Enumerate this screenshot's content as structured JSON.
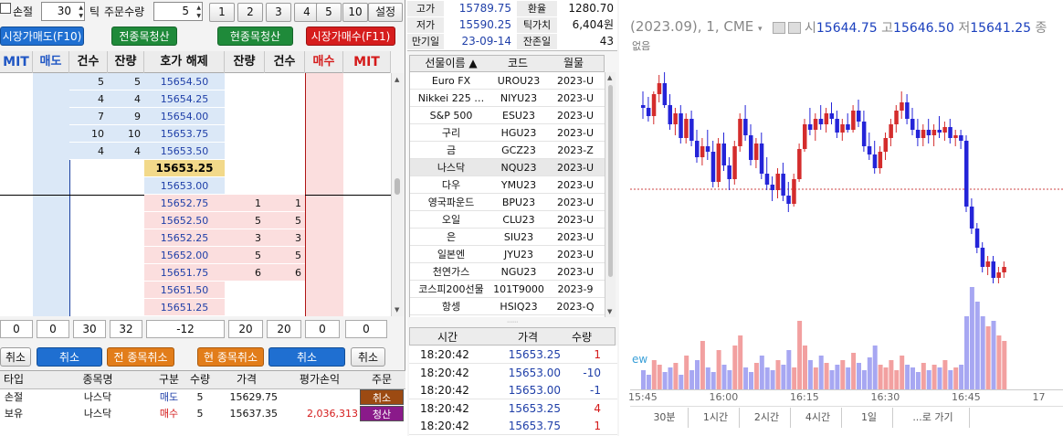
{
  "left": {
    "top": {
      "loss_label": "손절",
      "loss_value": "30",
      "tick_label": "틱",
      "qty_label": "주문수량",
      "qty_value": "5",
      "qty_buttons": [
        "1",
        "2",
        "3",
        "4",
        "5",
        "10"
      ],
      "settings_label": "설정"
    },
    "action_buttons": {
      "market_sell": "시장가매도(F10)",
      "all_close": "전종목청산",
      "cur_close": "현종목청산",
      "market_buy": "시장가매수(F11)"
    },
    "headers": {
      "mit_left": "MIT",
      "sell": "매도",
      "count": "건수",
      "remain": "잔량",
      "price": "호가 해제",
      "remain2": "잔량",
      "count2": "건수",
      "buy": "매수",
      "mit_right": "MIT"
    },
    "rows": [
      {
        "sc": "5",
        "sr": "5",
        "p": "15654.50",
        "br": "",
        "bc": ""
      },
      {
        "sc": "4",
        "sr": "4",
        "p": "15654.25",
        "br": "",
        "bc": ""
      },
      {
        "sc": "7",
        "sr": "9",
        "p": "15654.00",
        "br": "",
        "bc": ""
      },
      {
        "sc": "10",
        "sr": "10",
        "p": "15653.75",
        "br": "",
        "bc": ""
      },
      {
        "sc": "4",
        "sr": "4",
        "p": "15653.50",
        "br": "",
        "bc": ""
      },
      {
        "sc": "",
        "sr": "",
        "p": "15653.25",
        "br": "",
        "bc": ""
      },
      {
        "sc": "",
        "sr": "",
        "p": "15653.00",
        "br": "",
        "bc": ""
      },
      {
        "sc": "",
        "sr": "",
        "p": "15652.75",
        "br": "1",
        "bc": "1"
      },
      {
        "sc": "",
        "sr": "",
        "p": "15652.50",
        "br": "5",
        "bc": "5"
      },
      {
        "sc": "",
        "sr": "",
        "p": "15652.25",
        "br": "3",
        "bc": "3"
      },
      {
        "sc": "",
        "sr": "",
        "p": "15652.00",
        "br": "5",
        "bc": "5"
      },
      {
        "sc": "",
        "sr": "",
        "p": "15651.75",
        "br": "6",
        "bc": "6"
      },
      {
        "sc": "",
        "sr": "",
        "p": "15651.50",
        "br": "",
        "bc": ""
      },
      {
        "sc": "",
        "sr": "",
        "p": "15651.25",
        "br": "",
        "bc": ""
      }
    ],
    "totals": [
      "0",
      "0",
      "30",
      "32",
      "-12",
      "20",
      "20",
      "0",
      "0"
    ],
    "cancel_row": {
      "cancel1": "취소",
      "cancel2": "취소",
      "all_cancel": "전 종목취소",
      "cur_cancel": "현 종목취소",
      "cancel3": "취소",
      "cancel4": "취소"
    },
    "orders": {
      "headers": [
        "타입",
        "종목명",
        "구분",
        "수량",
        "가격",
        "평가손익",
        "주문"
      ],
      "rows": [
        {
          "type": "손절",
          "name": "나스닥",
          "side": "매도",
          "qty": "5",
          "price": "15629.75",
          "pnl": "",
          "action": "취소"
        },
        {
          "type": "보유",
          "name": "나스닥",
          "side": "매수",
          "qty": "5",
          "price": "15637.35",
          "pnl": "2,036,313",
          "action": "청산"
        }
      ]
    }
  },
  "mid": {
    "info": [
      {
        "l1": "고가",
        "v1": "15789.75",
        "l2": "환율",
        "v2": "1280.70"
      },
      {
        "l1": "저가",
        "v1": "15590.25",
        "l2": "틱가치",
        "v2": "6,404원"
      },
      {
        "l1": "만기일",
        "v1": "23-09-14",
        "l2": "잔존일",
        "v2": "43"
      }
    ],
    "list_headers": [
      "선물이름 ▲",
      "코드",
      "월물"
    ],
    "futures": [
      {
        "n": "Euro FX",
        "c": "UROU23",
        "m": "2023-U"
      },
      {
        "n": "Nikkei 225 …",
        "c": "NIYU23",
        "m": "2023-U"
      },
      {
        "n": "S&P 500",
        "c": "ESU23",
        "m": "2023-U"
      },
      {
        "n": "구리",
        "c": "HGU23",
        "m": "2023-U"
      },
      {
        "n": "금",
        "c": "GCZ23",
        "m": "2023-Z"
      },
      {
        "n": "나스닥",
        "c": "NQU23",
        "m": "2023-U"
      },
      {
        "n": "다우",
        "c": "YMU23",
        "m": "2023-U"
      },
      {
        "n": "영국파운드",
        "c": "BPU23",
        "m": "2023-U"
      },
      {
        "n": "오일",
        "c": "CLU23",
        "m": "2023-U"
      },
      {
        "n": "은",
        "c": "SIU23",
        "m": "2023-U"
      },
      {
        "n": "일본엔",
        "c": "JYU23",
        "m": "2023-U"
      },
      {
        "n": "천연가스",
        "c": "NGU23",
        "m": "2023-U"
      },
      {
        "n": "코스피200선물",
        "c": "101T9000",
        "m": "2023-9"
      },
      {
        "n": "항셍",
        "c": "HSIQ23",
        "m": "2023-Q"
      }
    ],
    "trade_headers": [
      "시간",
      "가격",
      "수량"
    ],
    "trades": [
      {
        "t": "18:20:42",
        "p": "15653.25",
        "q": "1",
        "d": "up"
      },
      {
        "t": "18:20:42",
        "p": "15653.00",
        "q": "-10",
        "d": "down"
      },
      {
        "t": "18:20:42",
        "p": "15653.00",
        "q": "-1",
        "d": "down"
      },
      {
        "t": "18:20:42",
        "p": "15653.25",
        "q": "4",
        "d": "up"
      },
      {
        "t": "18:20:42",
        "p": "15653.75",
        "q": "1",
        "d": "up"
      }
    ]
  },
  "chart": {
    "title": "(2023.09), 1, CME",
    "ohlc": {
      "o_label": "시",
      "o": "15644.75",
      "h_label": "고",
      "h": "15646.50",
      "l_label": "저",
      "l": "15641.25",
      "c_label": "종"
    },
    "sub_label": "없음",
    "vol_label": "ew",
    "times": [
      "15:45",
      "16:00",
      "16:15",
      "16:30",
      "16:45",
      "17"
    ],
    "toolbar": [
      "30분",
      "1시간",
      "2시간",
      "4시간",
      "1일",
      "...로 가기"
    ],
    "colors": {
      "up": "#d42c2c",
      "down": "#2424d8",
      "vol_up": "#f2a0a0",
      "vol_down": "#a7a7f2"
    }
  },
  "chart_data": {
    "type": "candlestick",
    "x_start": "15:45",
    "x_end": "17:00",
    "interval_min": 1,
    "price_range": [
      15560,
      15720
    ],
    "candles": [
      [
        15690,
        15700,
        15680,
        15688
      ],
      [
        15688,
        15696,
        15678,
        15682
      ],
      [
        15682,
        15700,
        15676,
        15698
      ],
      [
        15698,
        15712,
        15692,
        15706
      ],
      [
        15706,
        15714,
        15688,
        15690
      ],
      [
        15690,
        15698,
        15672,
        15676
      ],
      [
        15676,
        15688,
        15668,
        15684
      ],
      [
        15684,
        15690,
        15662,
        15666
      ],
      [
        15666,
        15684,
        15662,
        15680
      ],
      [
        15680,
        15686,
        15660,
        15664
      ],
      [
        15664,
        15672,
        15648,
        15652
      ],
      [
        15652,
        15666,
        15646,
        15660
      ],
      [
        15660,
        15672,
        15650,
        15656
      ],
      [
        15656,
        15664,
        15630,
        15634
      ],
      [
        15634,
        15666,
        15630,
        15662
      ],
      [
        15662,
        15670,
        15642,
        15646
      ],
      [
        15646,
        15652,
        15628,
        15636
      ],
      [
        15636,
        15664,
        15632,
        15660
      ],
      [
        15660,
        15684,
        15656,
        15680
      ],
      [
        15680,
        15690,
        15664,
        15668
      ],
      [
        15668,
        15676,
        15646,
        15650
      ],
      [
        15650,
        15666,
        15644,
        15662
      ],
      [
        15662,
        15670,
        15636,
        15640
      ],
      [
        15640,
        15652,
        15628,
        15632
      ],
      [
        15632,
        15638,
        15620,
        15628
      ],
      [
        15628,
        15644,
        15622,
        15640
      ],
      [
        15640,
        15648,
        15620,
        15624
      ],
      [
        15624,
        15634,
        15612,
        15618
      ],
      [
        15618,
        15640,
        15616,
        15636
      ],
      [
        15636,
        15662,
        15634,
        15658
      ],
      [
        15658,
        15680,
        15656,
        15676
      ],
      [
        15676,
        15688,
        15668,
        15672
      ],
      [
        15672,
        15684,
        15664,
        15680
      ],
      [
        15680,
        15690,
        15672,
        15676
      ],
      [
        15676,
        15688,
        15670,
        15684
      ],
      [
        15684,
        15692,
        15676,
        15680
      ],
      [
        15680,
        15686,
        15666,
        15670
      ],
      [
        15670,
        15680,
        15664,
        15676
      ],
      [
        15676,
        15684,
        15670,
        15672
      ],
      [
        15672,
        15690,
        15670,
        15686
      ],
      [
        15686,
        15694,
        15674,
        15678
      ],
      [
        15678,
        15686,
        15656,
        15660
      ],
      [
        15660,
        15670,
        15650,
        15654
      ],
      [
        15654,
        15664,
        15640,
        15644
      ],
      [
        15644,
        15660,
        15640,
        15656
      ],
      [
        15656,
        15670,
        15650,
        15666
      ],
      [
        15666,
        15680,
        15660,
        15676
      ],
      [
        15676,
        15690,
        15670,
        15686
      ],
      [
        15686,
        15700,
        15680,
        15692
      ],
      [
        15692,
        15698,
        15676,
        15680
      ],
      [
        15680,
        15688,
        15668,
        15672
      ],
      [
        15672,
        15680,
        15660,
        15666
      ],
      [
        15666,
        15676,
        15660,
        15672
      ],
      [
        15672,
        15680,
        15662,
        15668
      ],
      [
        15668,
        15676,
        15660,
        15672
      ],
      [
        15672,
        15682,
        15666,
        15670
      ],
      [
        15670,
        15678,
        15664,
        15674
      ],
      [
        15674,
        15680,
        15662,
        15666
      ],
      [
        15666,
        15672,
        15660,
        15668
      ],
      [
        15668,
        15672,
        15658,
        15664
      ],
      [
        15664,
        15668,
        15612,
        15616
      ],
      [
        15616,
        15622,
        15596,
        15600
      ],
      [
        15600,
        15604,
        15582,
        15586
      ],
      [
        15586,
        15590,
        15568,
        15572
      ],
      [
        15572,
        15580,
        15566,
        15576
      ],
      [
        15576,
        15580,
        15560,
        15564
      ],
      [
        15564,
        15572,
        15560,
        15568
      ],
      [
        15568,
        15576,
        15564,
        15572
      ]
    ],
    "volumes": [
      8,
      6,
      12,
      10,
      7,
      9,
      11,
      6,
      14,
      8,
      12,
      20,
      9,
      7,
      16,
      10,
      8,
      18,
      22,
      9,
      7,
      11,
      14,
      9,
      8,
      12,
      10,
      16,
      9,
      28,
      18,
      12,
      9,
      14,
      11,
      8,
      10,
      12,
      9,
      15,
      11,
      8,
      13,
      18,
      10,
      9,
      12,
      8,
      14,
      10,
      9,
      7,
      11,
      8,
      10,
      9,
      12,
      8,
      9,
      10,
      30,
      42,
      36,
      30,
      26,
      28,
      22,
      20
    ]
  }
}
